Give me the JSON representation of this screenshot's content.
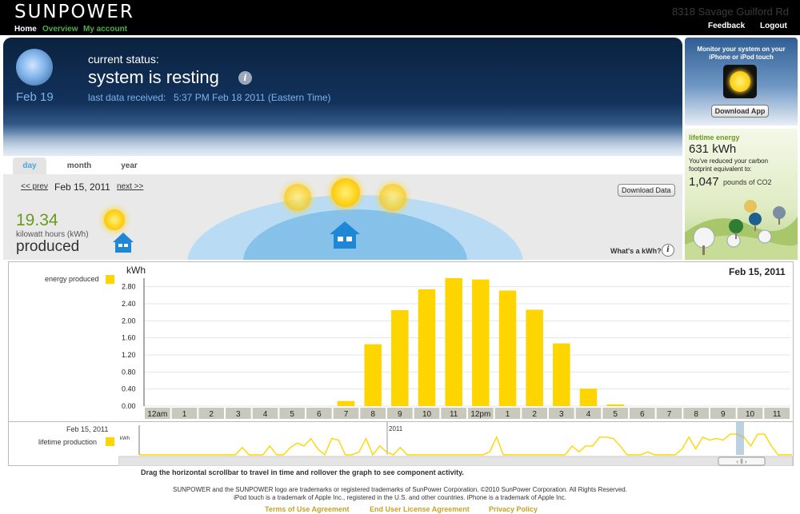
{
  "header": {
    "logo_text": "SUNPOWER",
    "address": "8318 Savage Guilford Rd",
    "nav": {
      "home": "Home",
      "overview": "Overview",
      "account": "My account"
    },
    "feedback": "Feedback",
    "logout": "Logout"
  },
  "status": {
    "date": "Feb 19",
    "label": "current status:",
    "value": "system is resting",
    "info_icon_char": "i",
    "last_label": "last data received:",
    "last_value": "5:37 PM Feb 18 2011 (Eastern Time)"
  },
  "tabs": [
    "day",
    "month",
    "year"
  ],
  "day_panel": {
    "prev": "<< prev",
    "date": "Feb 15, 2011",
    "next": "next >>",
    "download": "Download Data",
    "kwh_value": "19.34",
    "kwh_unit": "kilowatt hours (kWh)",
    "produced": "produced",
    "whats_kwh": "What's a kWh?",
    "whats_icon_char": "i"
  },
  "sidebar": {
    "monitor_text": "Monitor your system on your iPhone or iPod touch",
    "download_app": "Download App",
    "lifetime_label": "lifetime energy",
    "lifetime_value": "631 kWh",
    "lifetime_desc": "You've reduced your carbon footprint equivalent to:",
    "co2_value": "1,047",
    "co2_unit": "pounds of CO2"
  },
  "chart_data": {
    "type": "bar",
    "ylabel": "kWh",
    "date": "Feb 15, 2011",
    "legend": "energy produced",
    "series_color": "#ffd500",
    "ylim": [
      0,
      3.0
    ],
    "yticks": [
      "0.00",
      "0.40",
      "0.80",
      "1.20",
      "1.60",
      "2.00",
      "2.40",
      "2.80"
    ],
    "categories": [
      "12am",
      "1",
      "2",
      "3",
      "4",
      "5",
      "6",
      "7",
      "8",
      "9",
      "10",
      "11",
      "12pm",
      "1",
      "2",
      "3",
      "4",
      "5",
      "6",
      "7",
      "8",
      "9",
      "10",
      "11"
    ],
    "values": [
      0,
      0,
      0,
      0,
      0,
      0,
      0,
      0.12,
      1.45,
      2.25,
      2.74,
      3.0,
      2.97,
      2.71,
      2.26,
      1.47,
      0.41,
      0.04,
      0,
      0,
      0,
      0,
      0,
      0
    ]
  },
  "lifetime_chart": {
    "date": "Feb 15, 2011",
    "legend": "lifetime production",
    "ylabel": "kWh",
    "year_label": "2011",
    "series_color": "#ffd500",
    "values": [
      0,
      0,
      0,
      0,
      0,
      0,
      0,
      0,
      0,
      0,
      0,
      0,
      0,
      0,
      0,
      0.25,
      0,
      0,
      0,
      0.3,
      0,
      0,
      0.25,
      0.4,
      0.3,
      0.55,
      0.2,
      0,
      0.55,
      0.5,
      0,
      0,
      0.1,
      0.55,
      0,
      0.3,
      0.1,
      0,
      0.25,
      0,
      0,
      0,
      0,
      0,
      0,
      0,
      0,
      0,
      0,
      0,
      0,
      0.1,
      0.6,
      0,
      0,
      0,
      0,
      0,
      0,
      0,
      0,
      0,
      0,
      0.3,
      0.1,
      0.3,
      0.3,
      0.6,
      0.6,
      0.55,
      0.3,
      0,
      0,
      0,
      0.1,
      0,
      0,
      0,
      0,
      0.2,
      0.6,
      0.2,
      0.6,
      0.5,
      0.55,
      0.5,
      0.7,
      0.7,
      0.6,
      0.3,
      0.7,
      0.7,
      0.3,
      0,
      0,
      0
    ]
  },
  "instructions": "Drag the horizontal scrollbar to travel in time and rollover the graph to see component activity.",
  "footer": {
    "line1": "SUNPOWER and the SUNPOWER logo are trademarks or registered trademarks of SunPower Corporation. ©2010 SunPower Corporation. All Rights Reserved.",
    "line2": "iPod touch is a trademark of Apple Inc., registered in the U.S. and other countries.  iPhone is a trademark of Apple Inc.",
    "links": [
      "Terms of Use Agreement",
      "End User License Agreement",
      "Privacy Policy"
    ]
  }
}
